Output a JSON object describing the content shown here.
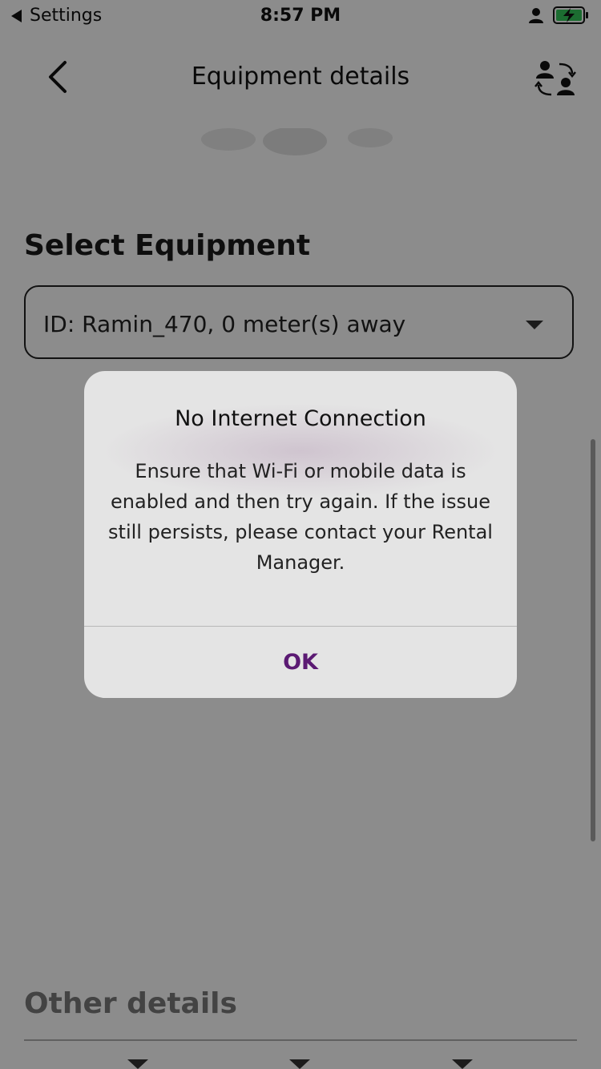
{
  "status_bar": {
    "back_label": "Settings",
    "time": "8:57 PM",
    "icons": [
      "user-icon",
      "battery-charging-icon"
    ]
  },
  "nav": {
    "title": "Equipment details",
    "back_icon": "chevron-left-icon",
    "action_icon": "swap-users-icon"
  },
  "select_equipment": {
    "title": "Select Equipment",
    "selected_value": "ID: Ramin_470, 0 meter(s) away",
    "dropdown_icon": "chevron-down-icon"
  },
  "other_details": {
    "title": "Other details"
  },
  "alert": {
    "title": "No Internet Connection",
    "message": "Ensure that Wi-Fi or mobile data is enabled and then try again. If the issue still persists, please contact your Rental Manager.",
    "ok_label": "OK"
  },
  "colors": {
    "accent": "#5b1a73",
    "battery_fill": "#33c659",
    "dialog_bg": "#e4e4e4"
  }
}
